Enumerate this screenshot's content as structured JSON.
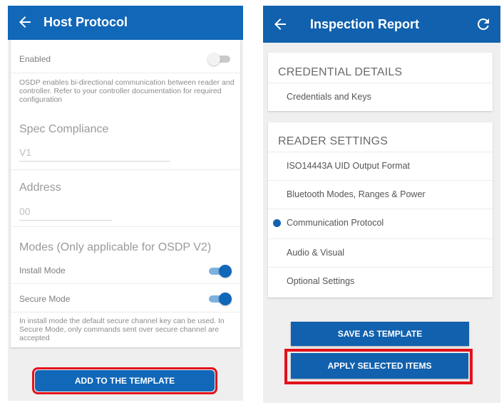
{
  "left": {
    "title": "Host Protocol",
    "enabled_label": "Enabled",
    "enabled_on": false,
    "osdp_help": "OSDP enables bi-directional communication between reader and controller. Refer to your controller documentation for required configuration",
    "spec_title": "Spec Compliance",
    "spec_value": "V1",
    "address_title": "Address",
    "address_value": "00",
    "modes_title": "Modes (Only applicable for OSDP V2)",
    "install_label": "Install Mode",
    "install_on": true,
    "secure_label": "Secure Mode",
    "secure_on": true,
    "modes_help": "In install mode the default secure channel key can be used. In Secure Mode, only commands sent over secure channel are accepted",
    "add_button": "ADD TO THE TEMPLATE"
  },
  "right": {
    "title": "Inspection Report",
    "credential_section": "CREDENTIAL DETAILS",
    "credential_items": [
      "Credentials and Keys"
    ],
    "reader_section": "READER SETTINGS",
    "reader_items": [
      "ISO14443A UID Output Format",
      "Bluetooth Modes, Ranges & Power",
      "Communication Protocol",
      "Audio & Visual",
      "Optional Settings"
    ],
    "save_button": "SAVE AS TEMPLATE",
    "apply_button": "APPLY SELECTED ITEMS"
  },
  "icons": {
    "back": "arrow-left-icon",
    "refresh": "refresh-icon",
    "selected": "bullet-dot-icon"
  },
  "colors": {
    "app_bar": "#1167b8",
    "accent": "#1167b8",
    "highlight": "#e3121b"
  }
}
